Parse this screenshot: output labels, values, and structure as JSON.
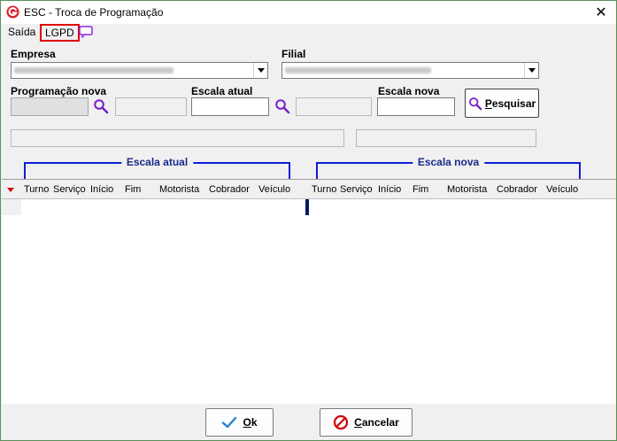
{
  "window": {
    "title": "ESC - Troca de Programação",
    "close_glyph": "✕"
  },
  "menu": {
    "saida": "Saída",
    "lgpd": "LGPD"
  },
  "form": {
    "empresa_label": "Empresa",
    "filial_label": "Filial",
    "programacao_nova_label": "Programação nova",
    "escala_atual_label": "Escala atual",
    "escala_nova_label": "Escala nova",
    "pesquisar_button": "esquisar",
    "pesquisar_mnemonic": "P"
  },
  "groups": {
    "escala_atual": "Escala atual",
    "escala_nova": "Escala nova"
  },
  "grid": {
    "columns_left": [
      "Turno",
      "Serviço",
      "Início",
      "Fim",
      "Motorista",
      "Cobrador",
      "Veículo"
    ],
    "columns_right": [
      "Turno",
      "Serviço",
      "Início",
      "Fim",
      "Motorista",
      "Cobrador",
      "Veículo"
    ]
  },
  "footer": {
    "ok_mnemonic": "O",
    "ok_rest": "k",
    "cancelar_mnemonic": "C",
    "cancelar_rest": "ancelar"
  },
  "colors": {
    "accent_blue": "#0a1fd6",
    "magnifier_purple": "#7a1fd0",
    "lgpd_highlight": "#e00000",
    "ok_check": "#2a7fd0",
    "cancel_red": "#d00000"
  }
}
